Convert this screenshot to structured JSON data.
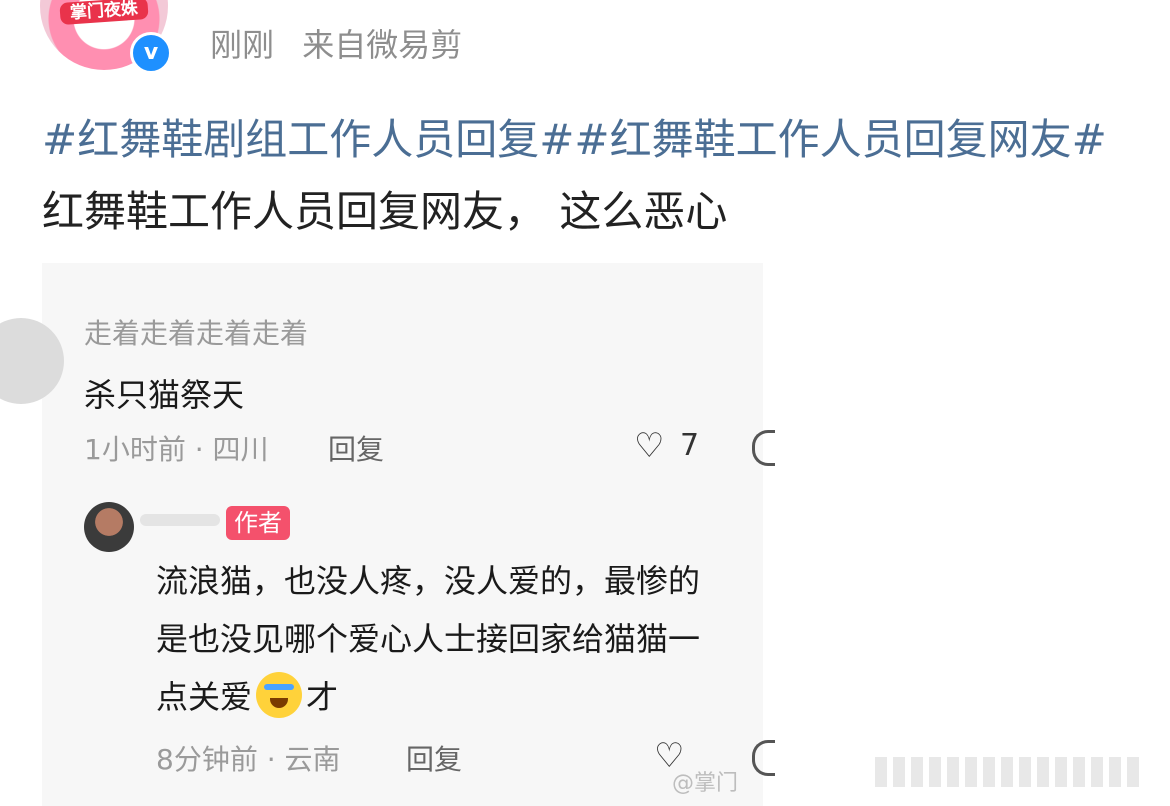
{
  "header": {
    "avatar_label": "掌门夜姝",
    "verified_mark": "v",
    "time": "刚刚",
    "source": "来自微易剪"
  },
  "post": {
    "tag1": "#红舞鞋剧组工作人员回复#",
    "tag2": "#红舞鞋工作人员回复网友#",
    "text": " 红舞鞋工作人员回复网友， 这么恶心"
  },
  "screenshot": {
    "comment": {
      "username": "走着走着走着走着",
      "text": "杀只猫祭天",
      "meta": "1小时前 · 四川",
      "reply": "回复",
      "likes": "7"
    },
    "reply": {
      "badge": "作者",
      "text_line1": "流浪猫，也没人疼，没人爱的，最惨的",
      "text_line2": "是也没见哪个爱心人士接回家给猫猫一",
      "text_line3_a": "点关爱",
      "text_line3_b": "才",
      "meta": "8分钟前 · 云南",
      "reply": "回复"
    },
    "watermark": "@掌门"
  }
}
